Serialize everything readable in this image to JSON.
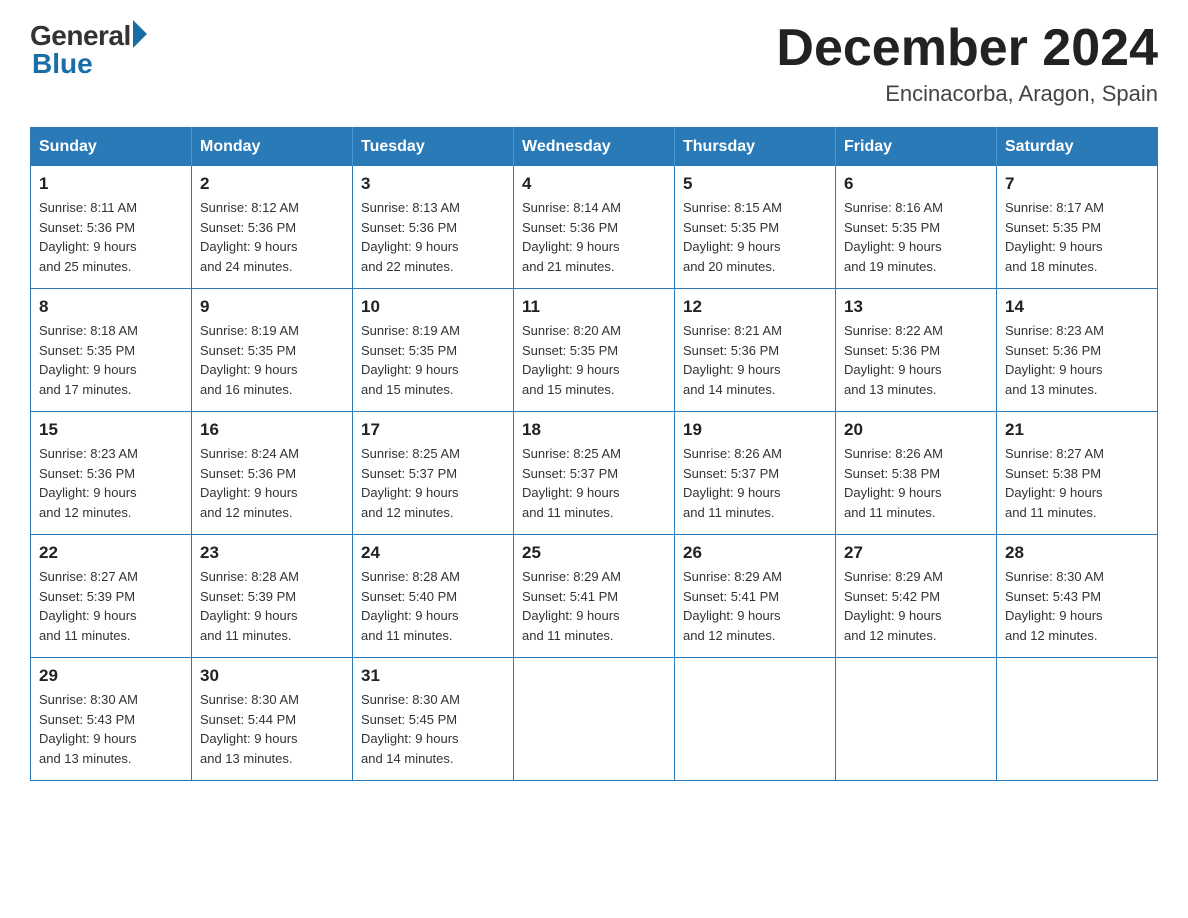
{
  "logo": {
    "general": "General",
    "blue": "Blue"
  },
  "title": {
    "month": "December 2024",
    "location": "Encinacorba, Aragon, Spain"
  },
  "days_of_week": [
    "Sunday",
    "Monday",
    "Tuesday",
    "Wednesday",
    "Thursday",
    "Friday",
    "Saturday"
  ],
  "weeks": [
    [
      {
        "day": "1",
        "sunrise": "8:11 AM",
        "sunset": "5:36 PM",
        "daylight": "9 hours and 25 minutes."
      },
      {
        "day": "2",
        "sunrise": "8:12 AM",
        "sunset": "5:36 PM",
        "daylight": "9 hours and 24 minutes."
      },
      {
        "day": "3",
        "sunrise": "8:13 AM",
        "sunset": "5:36 PM",
        "daylight": "9 hours and 22 minutes."
      },
      {
        "day": "4",
        "sunrise": "8:14 AM",
        "sunset": "5:36 PM",
        "daylight": "9 hours and 21 minutes."
      },
      {
        "day": "5",
        "sunrise": "8:15 AM",
        "sunset": "5:35 PM",
        "daylight": "9 hours and 20 minutes."
      },
      {
        "day": "6",
        "sunrise": "8:16 AM",
        "sunset": "5:35 PM",
        "daylight": "9 hours and 19 minutes."
      },
      {
        "day": "7",
        "sunrise": "8:17 AM",
        "sunset": "5:35 PM",
        "daylight": "9 hours and 18 minutes."
      }
    ],
    [
      {
        "day": "8",
        "sunrise": "8:18 AM",
        "sunset": "5:35 PM",
        "daylight": "9 hours and 17 minutes."
      },
      {
        "day": "9",
        "sunrise": "8:19 AM",
        "sunset": "5:35 PM",
        "daylight": "9 hours and 16 minutes."
      },
      {
        "day": "10",
        "sunrise": "8:19 AM",
        "sunset": "5:35 PM",
        "daylight": "9 hours and 15 minutes."
      },
      {
        "day": "11",
        "sunrise": "8:20 AM",
        "sunset": "5:35 PM",
        "daylight": "9 hours and 15 minutes."
      },
      {
        "day": "12",
        "sunrise": "8:21 AM",
        "sunset": "5:36 PM",
        "daylight": "9 hours and 14 minutes."
      },
      {
        "day": "13",
        "sunrise": "8:22 AM",
        "sunset": "5:36 PM",
        "daylight": "9 hours and 13 minutes."
      },
      {
        "day": "14",
        "sunrise": "8:23 AM",
        "sunset": "5:36 PM",
        "daylight": "9 hours and 13 minutes."
      }
    ],
    [
      {
        "day": "15",
        "sunrise": "8:23 AM",
        "sunset": "5:36 PM",
        "daylight": "9 hours and 12 minutes."
      },
      {
        "day": "16",
        "sunrise": "8:24 AM",
        "sunset": "5:36 PM",
        "daylight": "9 hours and 12 minutes."
      },
      {
        "day": "17",
        "sunrise": "8:25 AM",
        "sunset": "5:37 PM",
        "daylight": "9 hours and 12 minutes."
      },
      {
        "day": "18",
        "sunrise": "8:25 AM",
        "sunset": "5:37 PM",
        "daylight": "9 hours and 11 minutes."
      },
      {
        "day": "19",
        "sunrise": "8:26 AM",
        "sunset": "5:37 PM",
        "daylight": "9 hours and 11 minutes."
      },
      {
        "day": "20",
        "sunrise": "8:26 AM",
        "sunset": "5:38 PM",
        "daylight": "9 hours and 11 minutes."
      },
      {
        "day": "21",
        "sunrise": "8:27 AM",
        "sunset": "5:38 PM",
        "daylight": "9 hours and 11 minutes."
      }
    ],
    [
      {
        "day": "22",
        "sunrise": "8:27 AM",
        "sunset": "5:39 PM",
        "daylight": "9 hours and 11 minutes."
      },
      {
        "day": "23",
        "sunrise": "8:28 AM",
        "sunset": "5:39 PM",
        "daylight": "9 hours and 11 minutes."
      },
      {
        "day": "24",
        "sunrise": "8:28 AM",
        "sunset": "5:40 PM",
        "daylight": "9 hours and 11 minutes."
      },
      {
        "day": "25",
        "sunrise": "8:29 AM",
        "sunset": "5:41 PM",
        "daylight": "9 hours and 11 minutes."
      },
      {
        "day": "26",
        "sunrise": "8:29 AM",
        "sunset": "5:41 PM",
        "daylight": "9 hours and 12 minutes."
      },
      {
        "day": "27",
        "sunrise": "8:29 AM",
        "sunset": "5:42 PM",
        "daylight": "9 hours and 12 minutes."
      },
      {
        "day": "28",
        "sunrise": "8:30 AM",
        "sunset": "5:43 PM",
        "daylight": "9 hours and 12 minutes."
      }
    ],
    [
      {
        "day": "29",
        "sunrise": "8:30 AM",
        "sunset": "5:43 PM",
        "daylight": "9 hours and 13 minutes."
      },
      {
        "day": "30",
        "sunrise": "8:30 AM",
        "sunset": "5:44 PM",
        "daylight": "9 hours and 13 minutes."
      },
      {
        "day": "31",
        "sunrise": "8:30 AM",
        "sunset": "5:45 PM",
        "daylight": "9 hours and 14 minutes."
      },
      null,
      null,
      null,
      null
    ]
  ],
  "labels": {
    "sunrise": "Sunrise:",
    "sunset": "Sunset:",
    "daylight": "Daylight:"
  }
}
